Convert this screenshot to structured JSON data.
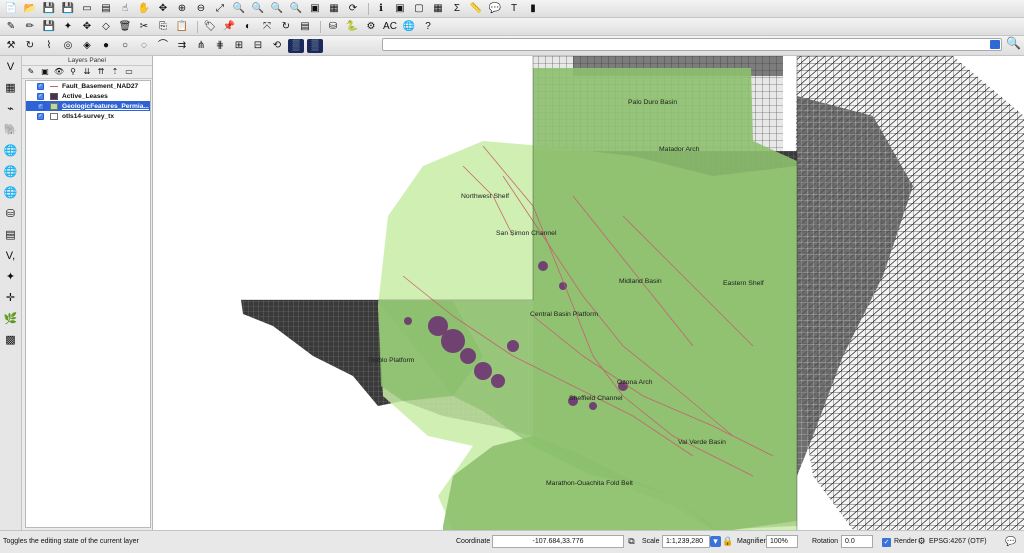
{
  "toolbar1_icons": [
    "new-file",
    "open",
    "save",
    "save-as",
    "new-layout",
    "layout-manager",
    "touch-zoom",
    "pan",
    "pan-to-selection",
    "zoom-in",
    "zoom-out",
    "zoom-full",
    "zoom-layer",
    "zoom-selection",
    "zoom-last",
    "zoom-next",
    "new-bookmark",
    "show-bookmarks",
    "refresh",
    "identify",
    "select",
    "deselect",
    "attribute-table",
    "statistics",
    "measure",
    "annotation",
    "tips",
    "python"
  ],
  "toolbar2_icons": [
    "digitize",
    "edit",
    "save-edits",
    "add-feature",
    "move-feature",
    "node-tool",
    "delete",
    "cut",
    "copy",
    "paste",
    "label",
    "pin-label",
    "show-label",
    "move-label",
    "rotate-label",
    "change-label",
    "plugin-db",
    "python-console",
    "tag",
    "ac-plugin",
    "globe",
    "help"
  ],
  "toolbar3_icons": [
    "adv-digitize",
    "rotate",
    "simplify",
    "add-ring",
    "add-part",
    "fill-ring",
    "delete-ring",
    "delete-part",
    "reshape",
    "offset",
    "split",
    "split-parts",
    "merge",
    "merge-attr",
    "rotate-symbol",
    "grid1",
    "grid2"
  ],
  "left_toolbar_icons": [
    "add-vector-layer",
    "add-raster-layer",
    "add-spatialite",
    "add-postgis",
    "add-wms",
    "add-wfs",
    "add-wcs",
    "add-oracle",
    "add-mssql",
    "add-delimited-text",
    "new-shapefile",
    "add-gps",
    "add-grass",
    "add-wfs-2"
  ],
  "layers_panel": {
    "title": "Layers Panel",
    "tool_icons": [
      "open-styling",
      "add-group",
      "manage-visibility",
      "filter-legend",
      "expand-all",
      "collapse-all",
      "move-up",
      "remove-layer"
    ],
    "layers": [
      {
        "name": "Fault_Basement_NAD27",
        "checked": true,
        "selected": false,
        "symbol": "line"
      },
      {
        "name": "Active_Leases",
        "checked": true,
        "selected": false,
        "symbol": "leases"
      },
      {
        "name": "GeologicFeatures_Permia...",
        "checked": true,
        "selected": true,
        "symbol": "geo"
      },
      {
        "name": "otls14-survey_tx",
        "checked": true,
        "selected": false,
        "symbol": "survey"
      }
    ]
  },
  "map_labels": [
    "Palo Duro Basin",
    "Matador Arch",
    "Northwest Shelf",
    "San Simon Channel",
    "Midland Basin",
    "Eastern Shelf",
    "Central Basin Platform",
    "Diablo Platform",
    "Ozona Arch",
    "Sheffield Channel",
    "Val Verde Basin",
    "Marathon-Ouachita Fold Belt"
  ],
  "colors": {
    "geologic_fill": "#8cc06e",
    "geologic_light": "#c8eca6",
    "survey_dark": "#3a3a3a",
    "fault_line": "#c85a6e",
    "lease": "#6b2c72"
  },
  "status_bar": {
    "message": "Toggles the editing state of the current layer",
    "coordinate_label": "Coordinate",
    "coordinate_value": "-107.684,33.776",
    "scale_label": "Scale",
    "scale_value": "1:1,239,280",
    "magnifier_label": "Magnifier",
    "magnifier_value": "100%",
    "rotation_label": "Rotation",
    "rotation_value": "0.0",
    "render_label": "Render",
    "render_checked": true,
    "crs_value": "EPSG:4267 (OTF)"
  }
}
